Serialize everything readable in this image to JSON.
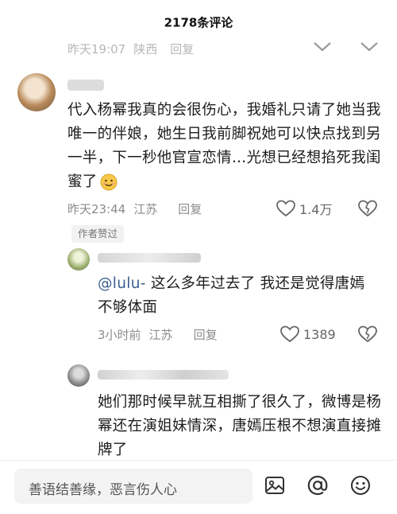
{
  "header": {
    "title": "2178条评论"
  },
  "comment0": {
    "time": "昨天19:07",
    "location": "陕西",
    "reply_label": "回复"
  },
  "comment1": {
    "text": "代入杨幂我真的会很伤心，我婚礼只请了她当我唯一的伴娘，她生日我前脚祝她可以快点找到另一半，下一秒他官宣恋情…光想已经想掐死我闺蜜了",
    "time": "昨天23:44",
    "location": "江苏",
    "reply_label": "回复",
    "like_count": "1.4万",
    "author_liked": "作者赞过"
  },
  "reply1": {
    "mention": "@lulu-",
    "text": " 这么多年过去了 我还是觉得唐嫣不够体面",
    "time": "3小时前",
    "location": "江苏",
    "reply_label": "回复",
    "like_count": "1389"
  },
  "reply2": {
    "text": "她们那时候早就互相撕了很久了，微博是杨幂还在演姐妹情深，唐嫣压根不想演直接摊牌了"
  },
  "bottom": {
    "placeholder": "善语结善缘，恶言伤人心",
    "icons": [
      "image-icon",
      "mention-icon",
      "emoji-icon"
    ]
  },
  "colors": {
    "mention": "#3c5e8f",
    "meta": "#8c8c8c"
  }
}
